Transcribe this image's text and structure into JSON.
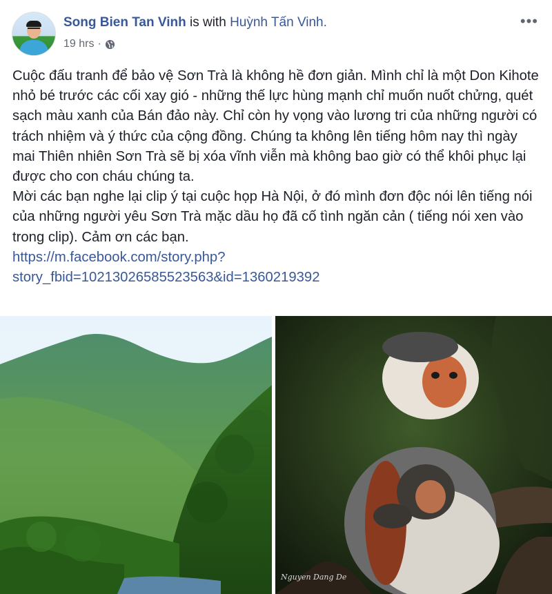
{
  "post": {
    "author": "Song Bien Tan Vinh",
    "with_text": "is with",
    "with_person": "Huỳnh Tấn Vinh.",
    "time": "19 hrs",
    "dot": "·",
    "privacy_icon": "globe-icon",
    "more_icon": "more-options-icon",
    "more_glyph": "•••",
    "paragraph_1": "Cuộc đấu tranh để bảo vệ Sơn Trà là không hề đơn giản. Mình chỉ là một Don Kihote nhỏ bé trước các cối xay gió - những thế lực hùng mạnh chỉ muốn nuốt chửng, quét sạch màu xanh của Bán đảo này. Chỉ còn hy vọng vào lương tri của những người có trách nhiệm và ý thức của cộng đồng. Chúng ta không lên tiếng hôm nay thì ngày mai Thiên nhiên Sơn Trà sẽ bị xóa vĩnh viễn mà không bao giờ có thể khôi phục lại được cho con cháu chúng ta.",
    "paragraph_2": "Mời các bạn nghe lại clip ý tại cuộc họp Hà Nội, ở đó mình đơn độc nói lên tiếng nói của những người yêu Sơn Trà mặc dầu họ đã cố tình ngăn cản ( tiếng nói xen vào trong clip). Cảm ơn các bạn.",
    "link_line_1": "https://m.facebook.com/story.php?",
    "link_line_2": "story_fbid=10213026585523563&id=1360219392"
  },
  "photos": {
    "left_subject": "mountain-forest-photo",
    "right_subject": "douc-langur-mother-and-baby-photo",
    "right_credit": "Nguyen Dang De"
  },
  "colors": {
    "link": "#385898",
    "text": "#1d2129",
    "meta": "#606770"
  }
}
